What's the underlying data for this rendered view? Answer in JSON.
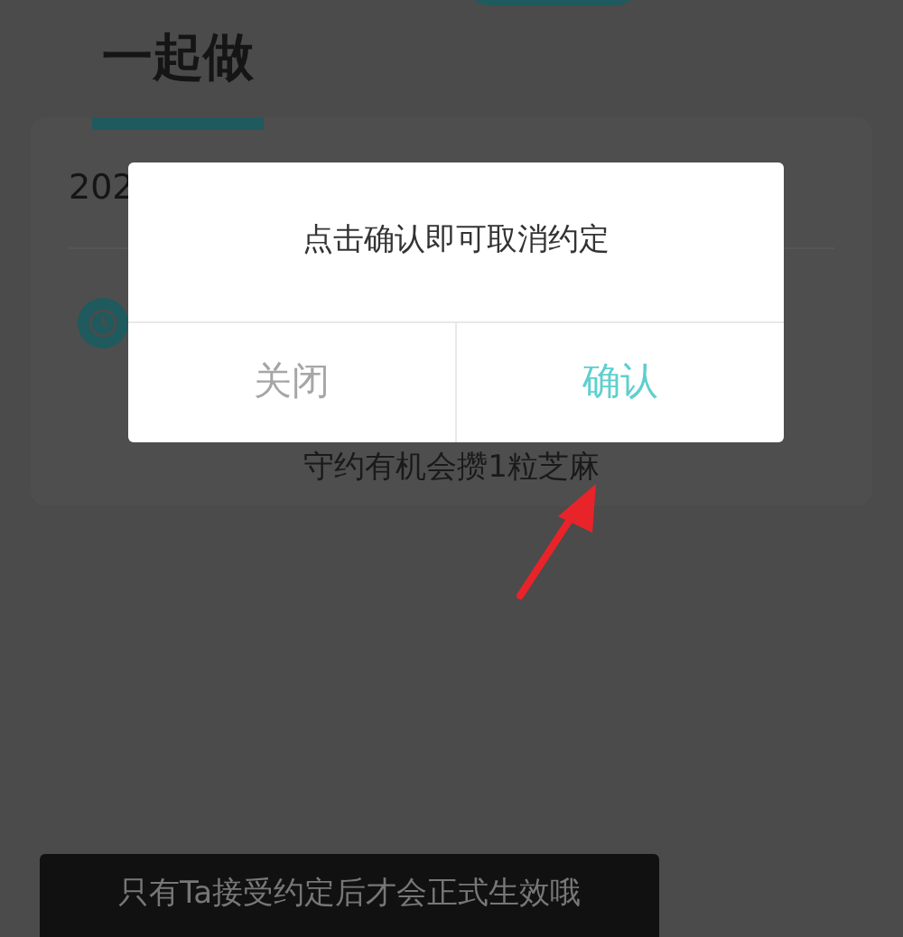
{
  "tabs": [
    {
      "label": "一起做",
      "selected": true
    }
  ],
  "card": {
    "date": "202",
    "note": "守约有机会攒1粒芝麻"
  },
  "dialog": {
    "message": "点击确认即可取消约定",
    "buttons": [
      {
        "label": "关闭",
        "kind": "cancel"
      },
      {
        "label": "确认",
        "kind": "confirm"
      }
    ]
  },
  "toast": {
    "text": "只有Ta接受约定后才会正式生效哦"
  }
}
